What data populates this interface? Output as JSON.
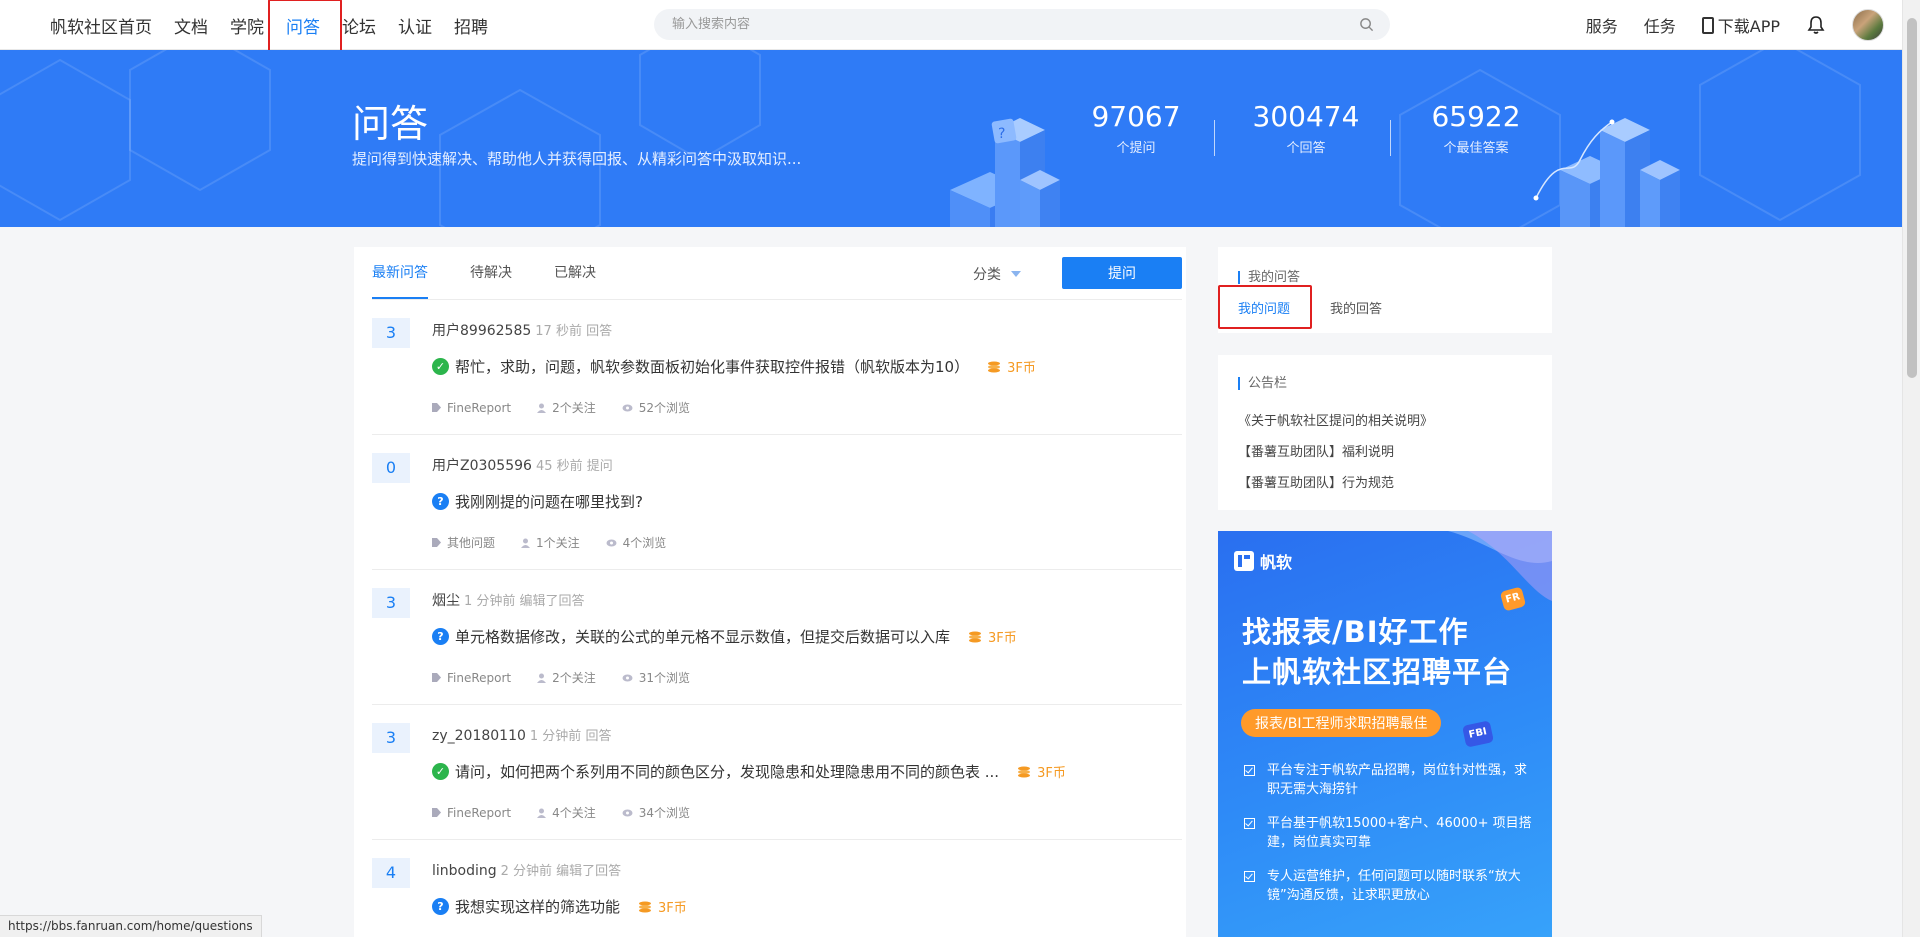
{
  "nav": {
    "links": [
      "帆软社区首页",
      "文档",
      "学院",
      "问答",
      "论坛",
      "认证",
      "招聘"
    ],
    "active_link": "问答",
    "search_placeholder": "输入搜索内容",
    "right": [
      "服务",
      "任务",
      "下载APP"
    ]
  },
  "banner": {
    "title": "问答",
    "subtitle": "提问得到快速解决、帮助他人并获得回报、从精彩问答中汲取知识...",
    "stats": [
      {
        "num": "97067",
        "label": "个提问"
      },
      {
        "num": "300474",
        "label": "个回答"
      },
      {
        "num": "65922",
        "label": "个最佳答案"
      }
    ]
  },
  "main": {
    "tabs": [
      "最新问答",
      "待解决",
      "已解决"
    ],
    "category_label": "分类",
    "ask_button": "提问",
    "questions": [
      {
        "count": "3",
        "user": "用户89962585",
        "time": "17 秒前 回答",
        "status": "solved",
        "title": "帮忙，求助，问题，帆软参数面板初始化事件获取控件报错（帆软版本为10）",
        "coin": "3F币",
        "tag": "FineReport",
        "follows": "2个关注",
        "views": "52个浏览"
      },
      {
        "count": "0",
        "user": "用户Z0305596",
        "time": "45 秒前 提问",
        "status": "pending",
        "title": "我刚刚提的问题在哪里找到?",
        "coin": "",
        "tag": "其他问题",
        "follows": "1个关注",
        "views": "4个浏览"
      },
      {
        "count": "3",
        "user": "烟尘",
        "time": "1 分钟前 编辑了回答",
        "status": "pending",
        "title": "单元格数据修改，关联的公式的单元格不显示数值，但提交后数据可以入库",
        "coin": "3F币",
        "tag": "FineReport",
        "follows": "2个关注",
        "views": "31个浏览"
      },
      {
        "count": "3",
        "user": "zy_20180110",
        "time": "1 分钟前 回答",
        "status": "solved",
        "title": "请问，如何把两个系列用不同的颜色区分，发现隐患和处理隐患用不同的颜色表 ...",
        "coin": "3F币",
        "tag": "FineReport",
        "follows": "4个关注",
        "views": "34个浏览"
      },
      {
        "count": "4",
        "user": "linboding",
        "time": "2 分钟前 编辑了回答",
        "status": "pending",
        "title": "我想实现这样的筛选功能",
        "coin": "3F币",
        "tag": "",
        "follows": "",
        "views": ""
      }
    ]
  },
  "sidebar": {
    "my_qa_title": "我的问答",
    "my_tabs": [
      "我的问题",
      "我的回答"
    ],
    "notice_title": "公告栏",
    "notices": [
      "《关于帆软社区提问的相关说明》",
      "【番薯互助团队】福利说明",
      "【番薯互助团队】行为规范"
    ]
  },
  "ad": {
    "logo": "帆软",
    "headline1": "找报表/BI好工作",
    "headline2": "上帆软社区招聘平台",
    "badge": "报表/BI工程师求职招聘最佳",
    "chip1": "FR",
    "chip2": "FBI",
    "points": [
      "平台专注于帆软产品招聘，岗位针对性强，求职无需大海捞针",
      "平台基于帆软15000+客户、46000+ 项目搭建，岗位真实可靠",
      "专人运营维护，任何问题可以随时联系“放大镜”沟通反馈，让求职更放心"
    ]
  },
  "status_url": "https://bbs.fanruan.com/home/questions",
  "colors": {
    "brand": "#1a7ff4",
    "banner": "#2f7bf6",
    "coin": "#f59a23",
    "solved": "#2cb54c",
    "highlight": "#e02020"
  }
}
